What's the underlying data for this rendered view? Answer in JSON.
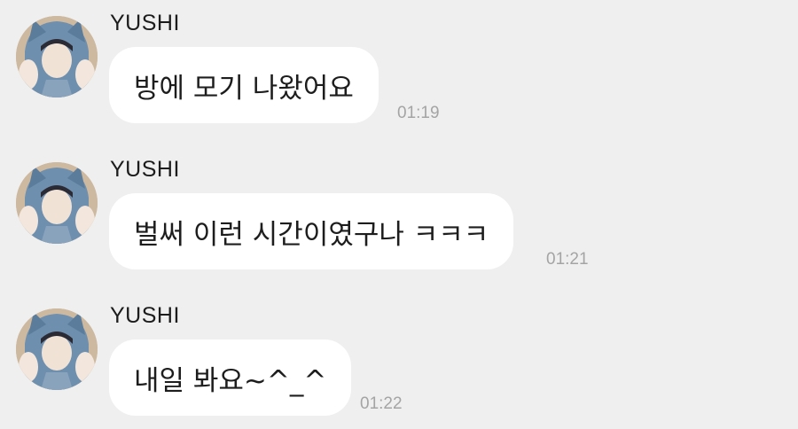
{
  "messages": [
    {
      "sender": "YUSHI",
      "text": "방에 모기 나왔어요",
      "time": "01:19"
    },
    {
      "sender": "YUSHI",
      "text": "벌써 이런 시간이였구나 ㅋㅋㅋ",
      "time": "01:21"
    },
    {
      "sender": "YUSHI",
      "text": "내일 봐요~^_^",
      "time": "01:22"
    }
  ],
  "colors": {
    "background": "#efefef",
    "bubble": "#ffffff",
    "timestamp": "#a4a4a4"
  }
}
